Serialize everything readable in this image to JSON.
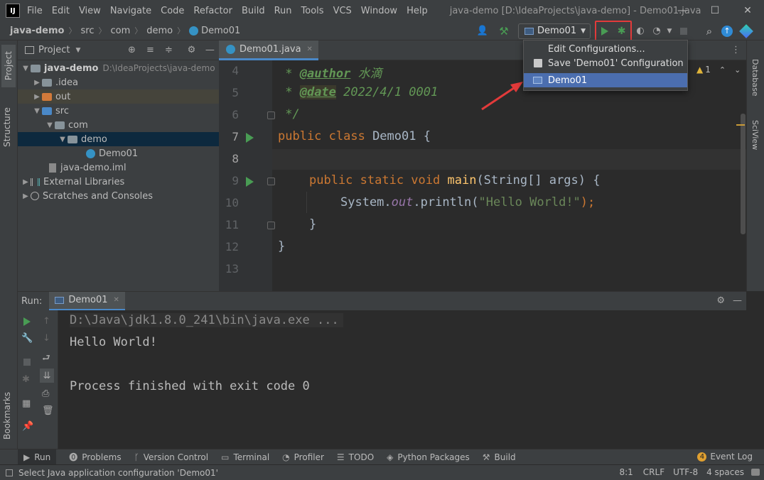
{
  "titlebar": {
    "menu": [
      "File",
      "Edit",
      "View",
      "Navigate",
      "Code",
      "Refactor",
      "Build",
      "Run",
      "Tools",
      "VCS",
      "Window",
      "Help"
    ],
    "title": "java-demo [D:\\IdeaProjects\\java-demo] - Demo01.java"
  },
  "navbar": {
    "crumbs": [
      "java-demo",
      "src",
      "com",
      "demo",
      "Demo01"
    ],
    "run_config": "Demo01"
  },
  "dropdown": {
    "items": [
      "Edit Configurations...",
      "Save 'Demo01' Configuration",
      "Demo01"
    ]
  },
  "project": {
    "title": "Project",
    "root": "java-demo",
    "root_path": "D:\\IdeaProjects\\java-demo",
    "items": [
      ".idea",
      "out",
      "src",
      "com",
      "demo",
      "Demo01",
      "java-demo.iml",
      "External Libraries",
      "Scratches and Consoles"
    ]
  },
  "left_strip": [
    "Project",
    "Structure",
    "Bookmarks"
  ],
  "right_strip": [
    "Database",
    "SciView"
  ],
  "editor": {
    "tab": "Demo01.java",
    "warnings": "1",
    "line_numbers": [
      "4",
      "5",
      "6",
      "7",
      "8",
      "9",
      "10",
      "11",
      "12",
      "13"
    ],
    "lines": {
      "l4_star": " * ",
      "l4_tag": "@author",
      "l4_text": " 水滴",
      "l5_star": " * ",
      "l5_tag": "@date",
      "l5_text": " 2022/4/1 0001",
      "l6": " */",
      "l7_kw": "public class",
      "l7_rest": " Demo01 {",
      "l9_kw": "public static void",
      "l9_fn": "main",
      "l9_rest": "(String[] args) {",
      "l10_a": "System.",
      "l10_field": "out",
      "l10_b": ".println(",
      "l10_str": "\"Hello World!\"",
      "l10_c": ");",
      "l11": "}",
      "l12": "}"
    }
  },
  "run": {
    "label": "Run:",
    "tab": "Demo01",
    "console": [
      "D:\\Java\\jdk1.8.0_241\\bin\\java.exe ...",
      "Hello World!",
      "",
      "Process finished with exit code 0"
    ]
  },
  "bottom_tabs": [
    "Run",
    "Problems",
    "Version Control",
    "Terminal",
    "Profiler",
    "TODO",
    "Python Packages",
    "Build"
  ],
  "event_log": {
    "count": "4",
    "label": "Event Log"
  },
  "status": {
    "message": "Select Java application configuration 'Demo01'",
    "position": "8:1",
    "line_sep": "CRLF",
    "encoding": "UTF-8",
    "indent": "4 spaces"
  },
  "colors": {
    "accent": "#4b6eaf",
    "highlight_box": "#e23a3a",
    "run_green": "#499c54"
  }
}
